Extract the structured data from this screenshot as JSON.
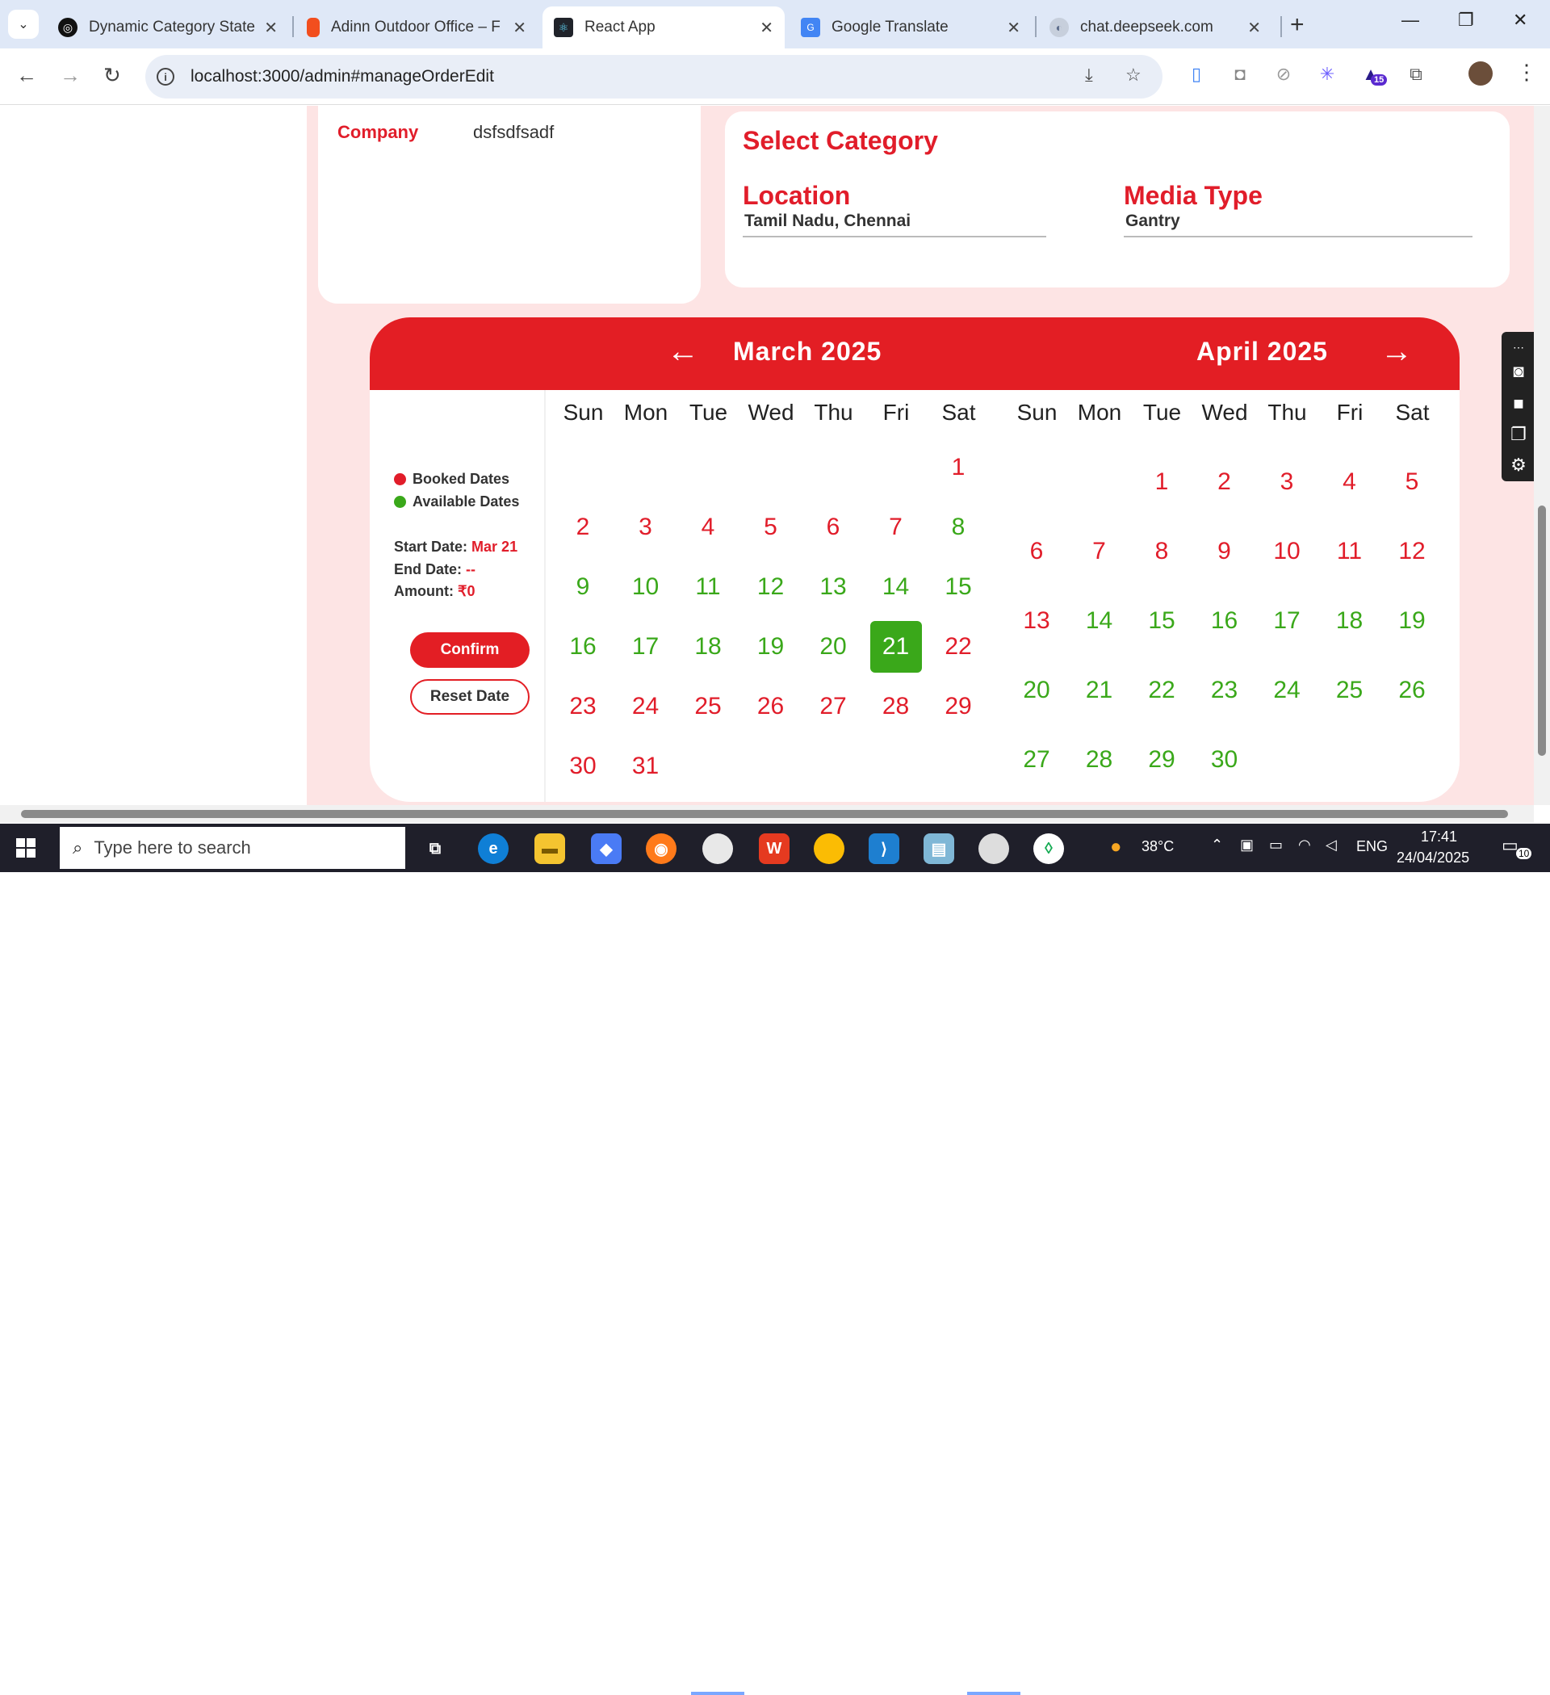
{
  "browser": {
    "tabs": [
      {
        "title": "Dynamic Category State Fi",
        "icon": "openai-icon"
      },
      {
        "title": "Adinn Outdoor Office – F",
        "icon": "figma-icon"
      },
      {
        "title": "React App",
        "icon": "react-icon"
      },
      {
        "title": "Google Translate",
        "icon": "translate-icon"
      },
      {
        "title": "chat.deepseek.com",
        "icon": "deepseek-icon"
      }
    ],
    "url": "localhost:3000/admin#manageOrderEdit",
    "extension_badge": "15"
  },
  "order": {
    "company_label": "Company",
    "company_value": "dsfsdfsadf"
  },
  "category": {
    "title": "Select Category",
    "location_label": "Location",
    "location_value": "Tamil Nadu, Chennai",
    "media_type_label": "Media Type",
    "media_type_value": "Gantry"
  },
  "calendar": {
    "left_month": "March 2025",
    "right_month": "April 2025",
    "weekdays": [
      "Sun",
      "Mon",
      "Tue",
      "Wed",
      "Thu",
      "Fri",
      "Sat"
    ],
    "legend": {
      "booked": "Booked Dates",
      "available": "Available Dates",
      "booked_color": "#e11d2a",
      "available_color": "#3aa81a"
    },
    "start_label": "Start Date:",
    "start_value": "Mar 21",
    "end_label": "End Date:",
    "end_value": "--",
    "amount_label": "Amount:",
    "amount_value": "₹0",
    "confirm_label": "Confirm",
    "reset_label": "Reset Date",
    "march": {
      "first_weekday": 6,
      "days": 31,
      "booked": [
        1,
        2,
        3,
        4,
        5,
        6,
        7,
        22,
        23,
        24,
        25,
        26,
        27,
        28,
        29,
        30,
        31
      ],
      "selected": [
        21
      ]
    },
    "april": {
      "first_weekday": 2,
      "days": 30,
      "booked": [
        1,
        2,
        3,
        4,
        5,
        6,
        7,
        8,
        9,
        10,
        11,
        12,
        13
      ],
      "selected": []
    }
  },
  "taskbar": {
    "search_placeholder": "Type here to search",
    "weather": "38°C",
    "lang": "ENG",
    "time": "17:41",
    "date": "24/04/2025",
    "notifications": "10"
  }
}
